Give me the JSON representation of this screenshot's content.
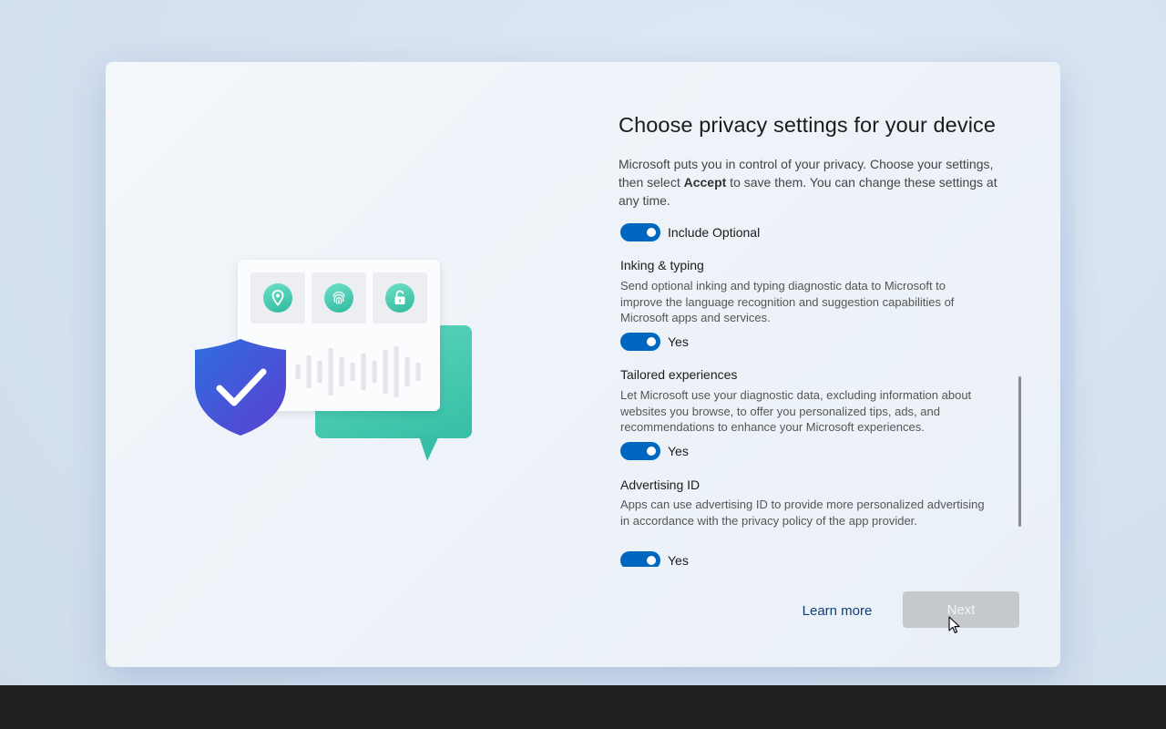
{
  "window": {
    "title": "Choose privacy settings for your device",
    "intro_before": "Microsoft puts you in control of your privacy. Choose your settings, then select ",
    "intro_bold": "Accept",
    "intro_after": " to save them. You can change these settings at any time."
  },
  "illustration": {
    "icons": [
      "location-pin-icon",
      "fingerprint-icon",
      "unlock-icon",
      "shield-check-icon"
    ],
    "colors": {
      "teal": "#3cc5ad",
      "shield_blue": "#3a5fd8",
      "shield_purple": "#5b46d0"
    }
  },
  "settings": [
    {
      "title": "",
      "description": "",
      "toggle_label": "Include Optional",
      "toggle_on": true
    },
    {
      "title": "Inking & typing",
      "description": "Send optional inking and typing diagnostic data to Microsoft to improve the language recognition and suggestion capabilities of Microsoft apps and services.",
      "toggle_label": "Yes",
      "toggle_on": true
    },
    {
      "title": "Tailored experiences",
      "description": "Let Microsoft use your diagnostic data, excluding information about websites you browse, to offer you personalized tips, ads, and recommendations to enhance your Microsoft experiences.",
      "toggle_label": "Yes",
      "toggle_on": true
    },
    {
      "title": "Advertising ID",
      "description": "Apps can use advertising ID to provide more personalized advertising in accordance with the privacy policy of the app provider.",
      "toggle_label": "Yes",
      "toggle_on": true
    }
  ],
  "footer": {
    "learn_more": "Learn more",
    "next": "Next"
  },
  "colors": {
    "accent": "#0067c0",
    "button_disabled": "#c5c8cc",
    "taskbar": "#202020"
  }
}
